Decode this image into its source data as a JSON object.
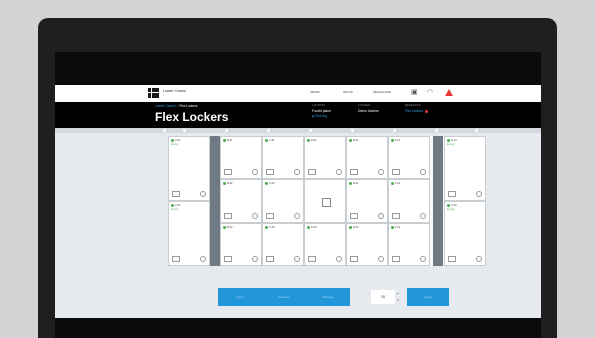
{
  "app": {
    "name": "Locker Control",
    "title": "Flex Lockers"
  },
  "nav": {
    "items": [
      "ADMIN",
      "SETUP",
      "MESSAGING"
    ],
    "icons": [
      "grid-icon",
      "bell-icon",
      "alert-icon"
    ]
  },
  "breadcrumb": {
    "parent": "Locker Control",
    "separator": ">",
    "current": "Flex Lockers"
  },
  "header_meta": [
    {
      "label": "LOCATION",
      "value": "Fourth place",
      "link": "Test log"
    },
    {
      "label": "LOCKERS",
      "value": "Demo lockers"
    },
    {
      "label": "MESSAGING",
      "value": "Flex Lockers",
      "status_color": "#e53935"
    }
  ],
  "lockers": {
    "left_column": [
      {
        "number": "A-01",
        "status": "Empty"
      },
      {
        "number": "A-02",
        "status": "Empty"
      }
    ],
    "middle_rows": [
      [
        "B-01",
        "C-01",
        "D-01",
        "E-01",
        "F-01"
      ],
      [
        "B-02",
        "C-02",
        "",
        "E-02",
        "F-02"
      ],
      [
        "B-03",
        "C-03",
        "D-03",
        "E-03",
        "F-03"
      ]
    ],
    "right_column": [
      {
        "number": "G-01",
        "status": "Empty"
      },
      {
        "number": "G-02",
        "status": "Empty"
      }
    ]
  },
  "actions": {
    "buttons": [
      "Open",
      "Reserve",
      "Release"
    ],
    "quantity": "20",
    "submit": "Apply"
  },
  "colors": {
    "accent": "#2196d9",
    "ok": "#4caf50",
    "alert": "#e53935",
    "header": "#000000"
  }
}
